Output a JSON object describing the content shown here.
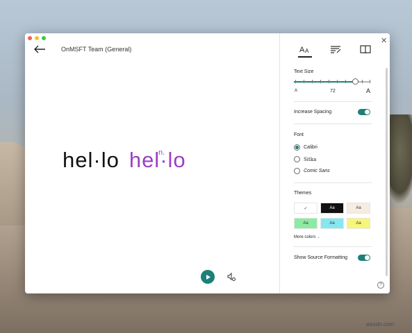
{
  "window": {
    "title": "OnMSFT Team (General)"
  },
  "reader": {
    "word_plain": "hel·lo",
    "word_highlight": "hel·lo",
    "part_of_speech": "n."
  },
  "panel": {
    "text_size": {
      "heading": "Text Size",
      "small_glyph": "A",
      "value": "72",
      "large_glyph": "A",
      "level_fraction": 0.8
    },
    "increase_spacing": {
      "label": "Increase Spacing",
      "on": true
    },
    "font": {
      "heading": "Font",
      "options": [
        "Calibri",
        "Sitka",
        "Comic Sans"
      ],
      "selected": "Calibri"
    },
    "themes": {
      "heading": "Themes",
      "swatches": [
        {
          "label": "✓",
          "bg": "#ffffff",
          "fg": "#333333"
        },
        {
          "label": "Aa",
          "bg": "#111111",
          "fg": "#ffffff"
        },
        {
          "label": "Aa",
          "bg": "#f6ece0",
          "fg": "#333333"
        },
        {
          "label": "Aa",
          "bg": "#8eeaa3",
          "fg": "#333333"
        },
        {
          "label": "Aa",
          "bg": "#86e7ee",
          "fg": "#333333"
        },
        {
          "label": "Aa",
          "bg": "#f7f57a",
          "fg": "#333333"
        }
      ],
      "more": "More colors"
    },
    "show_source": {
      "label": "Show Source Formatting",
      "on": true
    },
    "help": "?"
  },
  "watermark": "wsxdn.com",
  "colors": {
    "accent": "#1d7f79",
    "highlight": "#9b3fc7"
  },
  "icons": [
    "back-arrow-icon",
    "text-options-icon",
    "grammar-tools-icon",
    "reading-preferences-icon",
    "close-icon",
    "play-icon",
    "voice-settings-icon"
  ]
}
